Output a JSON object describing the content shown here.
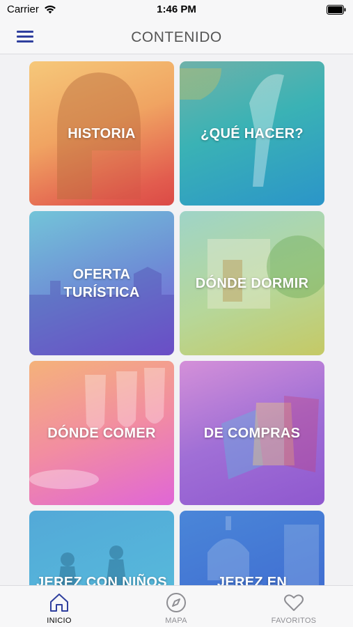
{
  "status_bar": {
    "carrier": "Carrier",
    "time": "1:46 PM"
  },
  "header": {
    "title": "CONTENIDO",
    "menu_icon": "hamburger-menu-icon"
  },
  "tiles": [
    {
      "label": "HISTORIA"
    },
    {
      "label": "¿QUÉ HACER?"
    },
    {
      "label": "OFERTA TURÍSTICA"
    },
    {
      "label": "DÓNDE DORMIR"
    },
    {
      "label": "DÓNDE COMER"
    },
    {
      "label": "DE COMPRAS"
    },
    {
      "label": "JEREZ CON NIÑOS"
    },
    {
      "label": "JEREZ EN"
    }
  ],
  "tab_bar": {
    "items": [
      {
        "label": "INICIO",
        "icon": "home-icon",
        "active": true
      },
      {
        "label": "MAPA",
        "icon": "compass-icon",
        "active": false
      },
      {
        "label": "FAVORITOS",
        "icon": "heart-icon",
        "active": false
      }
    ]
  },
  "colors": {
    "accent": "#2f3f9e",
    "inactive": "#8e8e93",
    "title": "#555555"
  }
}
